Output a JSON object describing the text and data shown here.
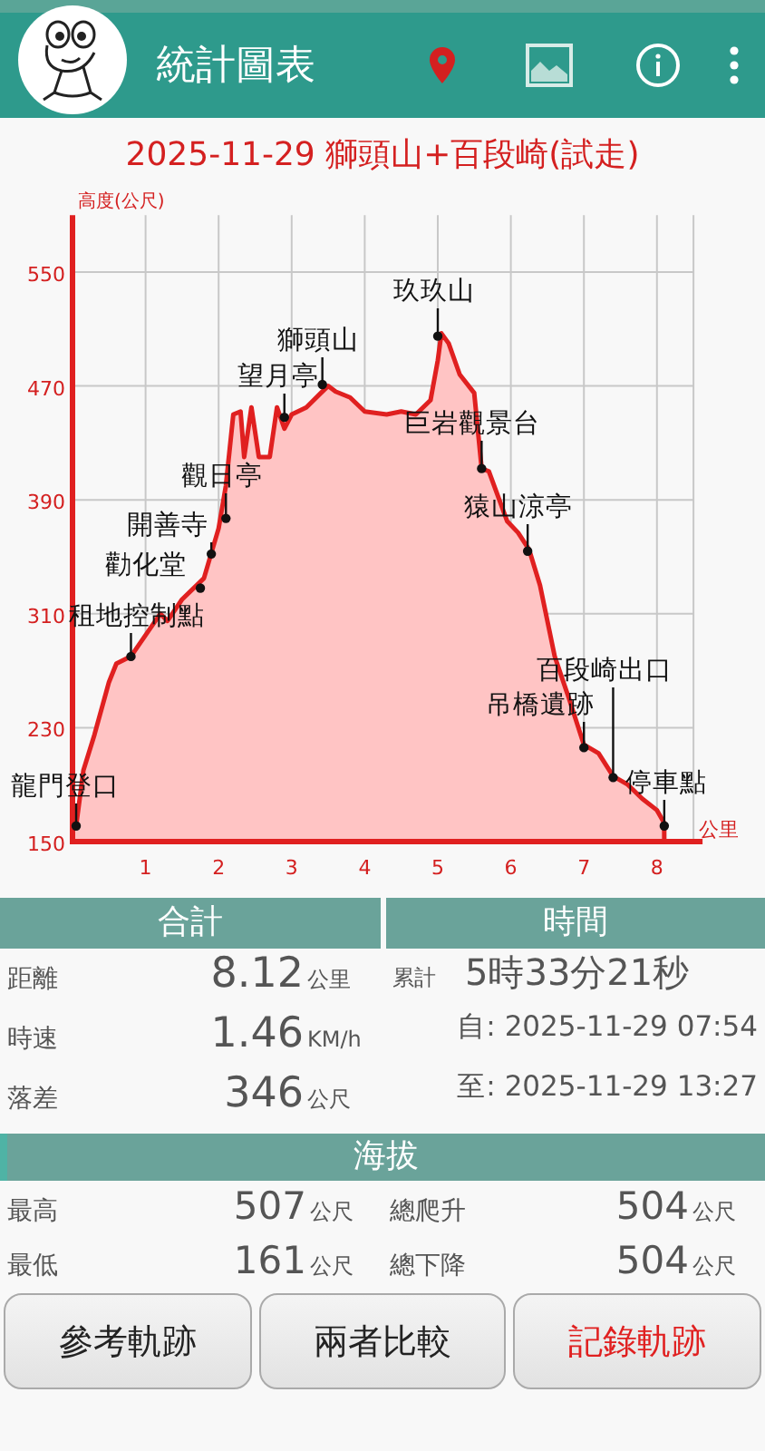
{
  "app_bar": {
    "title": "統計圖表"
  },
  "track_title": "2025-11-29 獅頭山+百段崎(試走)",
  "chart": {
    "chart_data": {
      "type": "area",
      "ylabel": "高度(公尺)",
      "xlabel": "公里",
      "x": [
        0,
        0.05,
        0.15,
        0.3,
        0.5,
        0.6,
        0.8,
        1.0,
        1.2,
        1.3,
        1.5,
        1.8,
        2.0,
        2.1,
        2.2,
        2.3,
        2.35,
        2.45,
        2.55,
        2.7,
        2.8,
        2.9,
        3.0,
        3.2,
        3.4,
        3.5,
        3.6,
        3.8,
        4.0,
        4.3,
        4.5,
        4.7,
        4.9,
        5.0,
        5.05,
        5.15,
        5.3,
        5.5,
        5.6,
        5.7,
        5.95,
        6.1,
        6.25,
        6.4,
        6.6,
        6.8,
        7.0,
        7.2,
        7.4,
        7.6,
        7.8,
        8.0,
        8.1
      ],
      "grid": true,
      "series": [
        {
          "color": "#e02020",
          "values": [
            170,
            161,
            200,
            225,
            262,
            275,
            280,
            295,
            310,
            305,
            320,
            335,
            370,
            400,
            450,
            452,
            420,
            455,
            420,
            420,
            455,
            440,
            450,
            455,
            465,
            470,
            466,
            462,
            452,
            450,
            452,
            450,
            460,
            488,
            507,
            500,
            478,
            465,
            412,
            410,
            375,
            367,
            355,
            330,
            280,
            250,
            218,
            212,
            196,
            190,
            180,
            172,
            163
          ]
        }
      ],
      "xlim": [
        0,
        8.5
      ],
      "ylim": [
        150,
        590
      ],
      "xticks": [
        1,
        2,
        3,
        4,
        5,
        6,
        7,
        8
      ],
      "yticks": [
        150,
        230,
        310,
        390,
        470,
        550
      ],
      "annotations": [
        {
          "text": "龍門登口",
          "x": 0.05,
          "y": 161
        },
        {
          "text": "租地控制點",
          "x": 0.8,
          "y": 280
        },
        {
          "text": "勸化堂",
          "x": 1.75,
          "y": 328
        },
        {
          "text": "開善寺",
          "x": 1.9,
          "y": 352
        },
        {
          "text": "觀日亭",
          "x": 2.1,
          "y": 377
        },
        {
          "text": "望月亭",
          "x": 2.9,
          "y": 448
        },
        {
          "text": "獅頭山",
          "x": 3.42,
          "y": 471
        },
        {
          "text": "玖玖山",
          "x": 5.0,
          "y": 505
        },
        {
          "text": "巨岩觀景台",
          "x": 5.6,
          "y": 412
        },
        {
          "text": "猿山涼亭",
          "x": 6.23,
          "y": 354
        },
        {
          "text": "百段崎出口",
          "x": 7.4,
          "y": 195
        },
        {
          "text": "吊橋遺跡",
          "x": 7.0,
          "y": 216
        },
        {
          "text": "停車點",
          "x": 8.1,
          "y": 161
        }
      ]
    }
  },
  "totals": {
    "header": "合計",
    "rows": [
      {
        "label": "距離",
        "value": "8.12",
        "unit": "公里"
      },
      {
        "label": "時速",
        "value": "1.46",
        "unit": "KM/h"
      },
      {
        "label": "落差",
        "value": "346",
        "unit": "公尺"
      }
    ]
  },
  "time": {
    "header": "時間",
    "total_label": "累計",
    "total": "5時33分21秒",
    "lines": [
      "自: 2025-11-29 07:54",
      "至: 2025-11-29 13:27"
    ]
  },
  "altitude": {
    "header": "海拔",
    "cells": [
      {
        "label": "最高",
        "value": "507",
        "unit": "公尺"
      },
      {
        "label": "總爬升",
        "value": "504",
        "unit": "公尺"
      },
      {
        "label": "最低",
        "value": "161",
        "unit": "公尺"
      },
      {
        "label": "總下降",
        "value": "504",
        "unit": "公尺"
      }
    ]
  },
  "buttons": [
    {
      "label": "參考軌跡",
      "kind": "normal"
    },
    {
      "label": "兩者比較",
      "kind": "normal"
    },
    {
      "label": "記錄軌跡",
      "kind": "accent"
    }
  ]
}
